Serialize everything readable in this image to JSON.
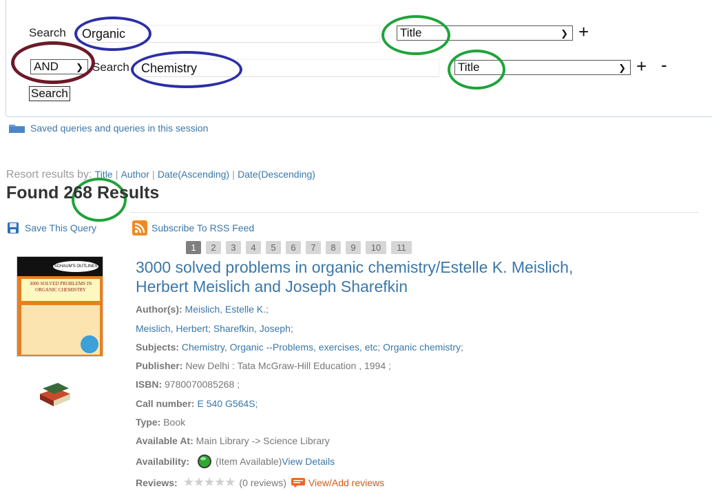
{
  "search": {
    "row1": {
      "label": "Search",
      "value": "Organic",
      "field": "Title",
      "plus": "+"
    },
    "row2": {
      "operator": "AND",
      "label": "Search",
      "value": "Chemistry",
      "field": "Title",
      "plus": "+",
      "minus": "-"
    },
    "submit_label": "Search"
  },
  "saved_queries_label": "Saved queries and queries in this session",
  "resort": {
    "label": "Resort results by:",
    "options": [
      "Title",
      "Author",
      "Date(Ascending)",
      "Date(Descending)"
    ],
    "sep": "|"
  },
  "found": {
    "prefix": "Found",
    "count": "268",
    "suffix": "Results"
  },
  "actions": {
    "save_query": "Save This Query",
    "rss": "Subscribe To RSS Feed"
  },
  "pagination": [
    "1",
    "2",
    "3",
    "4",
    "5",
    "6",
    "7",
    "8",
    "9",
    "10",
    "11"
  ],
  "current_page": "1",
  "result": {
    "title_line1": "3000 solved problems in organic chemistry/Estelle K. Meislich,",
    "title_line2": "Herbert Meislich and Joseph Sharefkin",
    "cover_text": {
      "series": "SCHAUM'S OUTLINES",
      "title": "3000 SOLVED PROBLEMS IN ORGANIC CHEMISTRY"
    },
    "authors_label": "Author(s):",
    "author1": "Meislich, Estelle K.",
    "author2": "Meislich, Herbert",
    "author3": "Sharefkin, Joseph",
    "subjects_label": "Subjects:",
    "subject1": "Chemistry, Organic --Problems, exercises, etc",
    "subject2": "Organic chemistry",
    "publisher_label": "Publisher:",
    "publisher": "New Delhi : Tata McGraw-Hill Education , 1994 ;",
    "isbn_label": "ISBN:",
    "isbn": "9780070085268 ;",
    "call_label": "Call number:",
    "call": "E 540 G564S;",
    "type_label": "Type:",
    "type": "Book",
    "available_label": "Available At:",
    "available": "Main Library -> Science Library",
    "availability_label": "Availability:",
    "availability": "(Item Available)",
    "view_details": "View Details",
    "reviews_label": "Reviews:",
    "reviews_count": "(0 reviews)",
    "view_add_reviews": "View/Add reviews",
    "rating": 0
  },
  "colors": {
    "link": "#3a77a8",
    "blue_ellipse": "#2b2fa6",
    "green_ellipse": "#1fa33a",
    "maroon_ellipse": "#6b1a2a",
    "review_link": "#d35a1a"
  }
}
